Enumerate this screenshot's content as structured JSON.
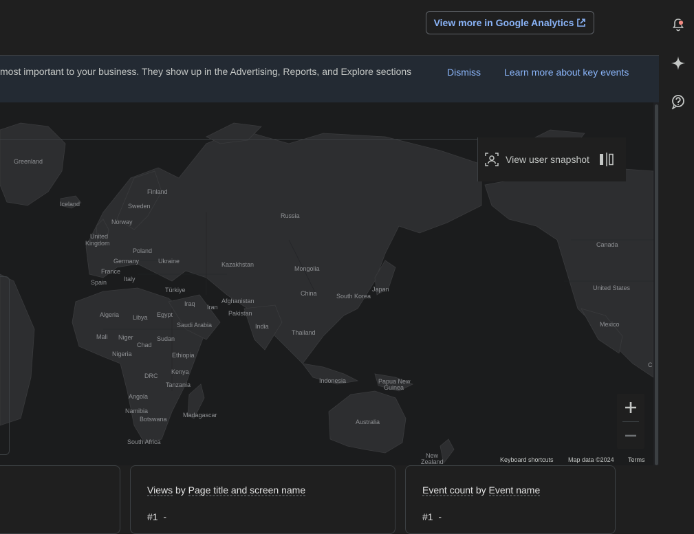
{
  "header": {
    "ga_button_label": "View more in Google Analytics"
  },
  "rail": {
    "icons": [
      "notifications-icon",
      "sparkle-icon",
      "help-icon"
    ]
  },
  "banner": {
    "text": "most important to your business. They show up in the Advertising, Reports, and Explore sections",
    "dismiss": "Dismiss",
    "learn_more": "Learn more about key events"
  },
  "snapshot": {
    "label": "View user snapshot"
  },
  "map": {
    "labels": {
      "greenland": "Greenland",
      "iceland": "Iceland",
      "finland": "Finland",
      "sweden": "Sweden",
      "norway": "Norway",
      "uk1": "United",
      "uk2": "Kingdom",
      "poland": "Poland",
      "germany": "Germany",
      "ukraine": "Ukraine",
      "france": "France",
      "italy": "Italy",
      "spain": "Spain",
      "turkiye": "Türkiye",
      "russia": "Russia",
      "kazakhstan": "Kazakhstan",
      "mongolia": "Mongolia",
      "china": "China",
      "south_korea": "South Korea",
      "japan": "Japan",
      "afghanistan": "Afghanistan",
      "pakistan": "Pakistan",
      "iraq": "Iraq",
      "iran": "Iran",
      "saudi": "Saudi Arabia",
      "india": "India",
      "thailand": "Thailand",
      "algeria": "Algeria",
      "libya": "Libya",
      "egypt": "Egypt",
      "mali": "Mali",
      "niger": "Niger",
      "chad": "Chad",
      "sudan": "Sudan",
      "nigeria": "Nigeria",
      "ethiopia": "Ethiopia",
      "drc": "DRC",
      "kenya": "Kenya",
      "tanzania": "Tanzania",
      "angola": "Angola",
      "namibia": "Namibia",
      "botswana": "Botswana",
      "madagascar": "Madagascar",
      "south_africa": "South Africa",
      "indonesia": "Indonesia",
      "png1": "Papua New",
      "png2": "Guinea",
      "australia": "Australia",
      "nz1": "New",
      "nz2": "Zealand",
      "canada": "Canada",
      "united_states": "United States",
      "mexico": "Mexico",
      "edge_c": "C"
    },
    "attribution": {
      "shortcuts": "Keyboard shortcuts",
      "data": "Map data ©2024",
      "terms": "Terms"
    }
  },
  "cards": [
    {
      "metric": "Views",
      "by": "by",
      "dimension": "Page title and screen name",
      "rank": "#1",
      "value": "-"
    },
    {
      "metric": "Event count",
      "by": "by",
      "dimension": "Event name",
      "rank": "#1",
      "value": "-"
    }
  ],
  "colors": {
    "background": "#1f1f1f",
    "accent": "#8ab4f8",
    "banner": "#232a33",
    "notification_dot": "#f28b82"
  }
}
